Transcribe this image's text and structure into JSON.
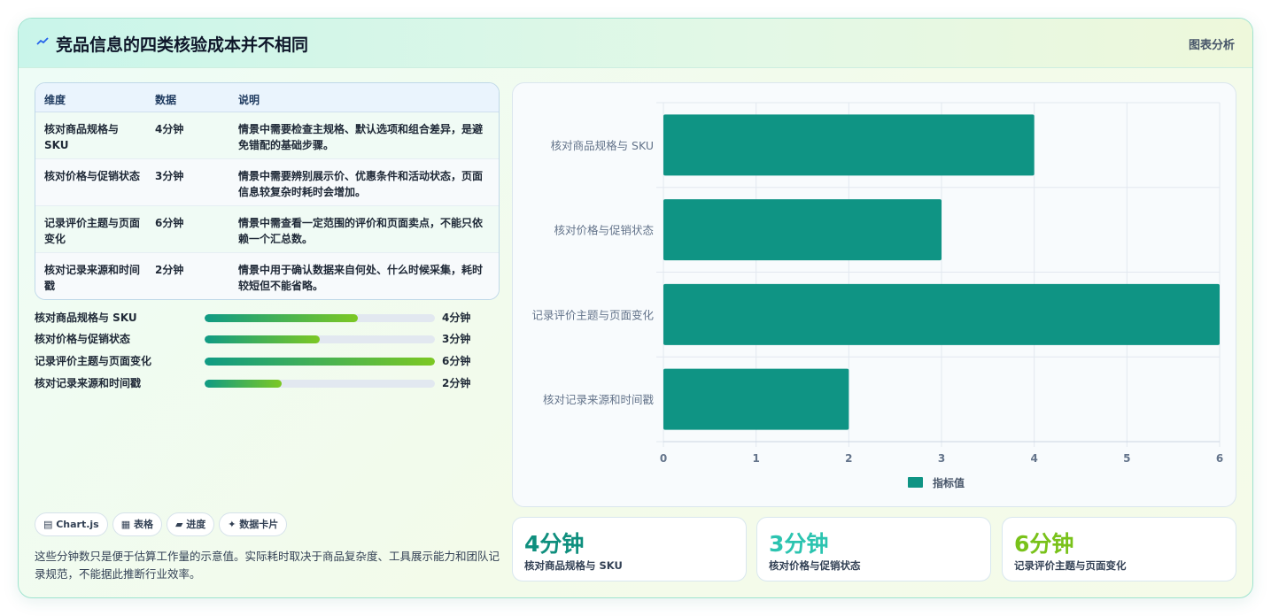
{
  "header": {
    "title": "竞品信息的四类核验成本并不相同",
    "tag": "图表分析"
  },
  "table": {
    "headers": [
      "维度",
      "数据",
      "说明"
    ],
    "rows": [
      {
        "dim": "核对商品规格与 SKU",
        "val": "4分钟",
        "desc": "情景中需要检查主规格、默认选项和组合差异，是避免错配的基础步骤。"
      },
      {
        "dim": "核对价格与促销状态",
        "val": "3分钟",
        "desc": "情景中需要辨别展示价、优惠条件和活动状态，页面信息较复杂时耗时会增加。"
      },
      {
        "dim": "记录评价主题与页面变化",
        "val": "6分钟",
        "desc": "情景中需查看一定范围的评价和页面卖点，不能只依赖一个汇总数。"
      },
      {
        "dim": "核对记录来源和时间戳",
        "val": "2分钟",
        "desc": "情景中用于确认数据来自何处、什么时候采集，耗时较短但不能省略。"
      }
    ]
  },
  "progress": {
    "max": 6,
    "items": [
      {
        "label": "核对商品规格与 SKU",
        "value": 4,
        "text": "4分钟"
      },
      {
        "label": "核对价格与促销状态",
        "value": 3,
        "text": "3分钟"
      },
      {
        "label": "记录评价主题与页面变化",
        "value": 6,
        "text": "6分钟"
      },
      {
        "label": "核对记录来源和时间戳",
        "value": 2,
        "text": "2分钟"
      }
    ]
  },
  "chips": [
    "▤ Chart.js",
    "▦ 表格",
    "▰ 进度",
    "✦ 数据卡片"
  ],
  "note": "这些分钟数只是便于估算工作量的示意值。实际耗时取决于商品复杂度、工具展示能力和团队记录规范，不能据此推断行业效率。",
  "stats": [
    {
      "value": "4分钟",
      "label": "核对商品规格与 SKU",
      "color": "#0f8f7e"
    },
    {
      "value": "3分钟",
      "label": "核对价格与促销状态",
      "color": "#2cc4b0"
    },
    {
      "value": "6分钟",
      "label": "记录评价主题与页面变化",
      "color": "#79c21a"
    }
  ],
  "chart_data": {
    "type": "bar",
    "orientation": "horizontal",
    "categories": [
      "核对商品规格与 SKU",
      "核对价格与促销状态",
      "记录评价主题与页面变化",
      "核对记录来源和时间戳"
    ],
    "series": [
      {
        "name": "指标值",
        "values": [
          4,
          3,
          6,
          2
        ]
      }
    ],
    "xlim": [
      0,
      6
    ],
    "xticks": [
      "0",
      "1",
      "2",
      "3",
      "4",
      "5",
      "6"
    ],
    "grid": true,
    "legend": "bottom",
    "bar_color": "#0f9484"
  }
}
